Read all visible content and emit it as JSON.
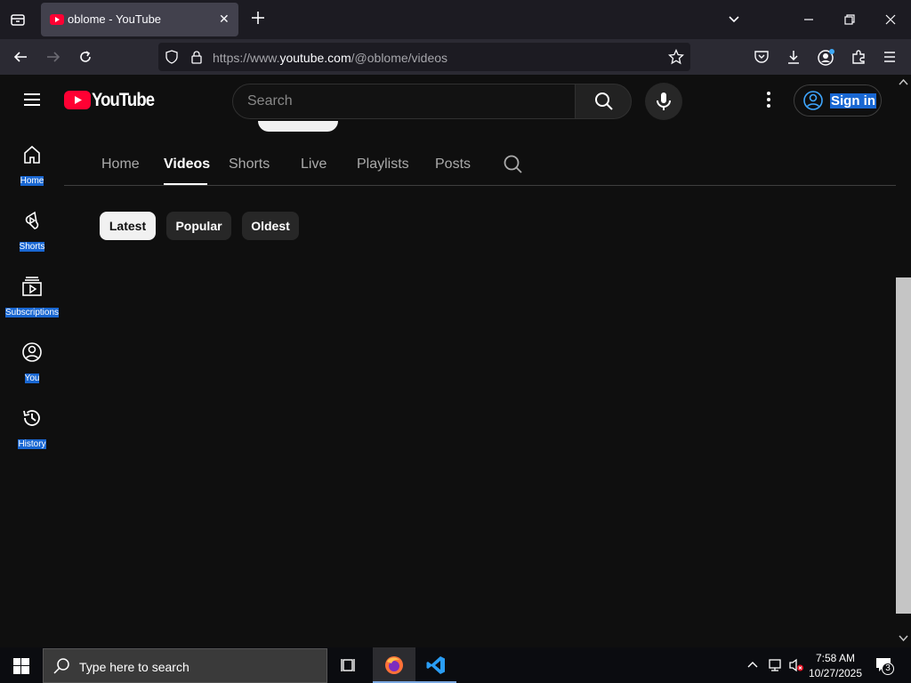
{
  "browser": {
    "tab_title": "oblome - YouTube",
    "url_prefix": "https://www.",
    "url_host": "youtube.com",
    "url_path": "/@oblome/videos"
  },
  "youtube": {
    "logo_text": "YouTube",
    "search_placeholder": "Search",
    "signin_label": "Sign in"
  },
  "sidebar": {
    "items": [
      {
        "label": "Home",
        "icon": "home-icon"
      },
      {
        "label": "Shorts",
        "icon": "shorts-icon"
      },
      {
        "label": "Subscriptions",
        "icon": "subscriptions-icon"
      },
      {
        "label": "You",
        "icon": "you-icon"
      },
      {
        "label": "History",
        "icon": "history-icon"
      }
    ]
  },
  "channel_tabs": {
    "items": [
      {
        "label": "Home"
      },
      {
        "label": "Videos",
        "active": true
      },
      {
        "label": "Shorts"
      },
      {
        "label": "Live"
      },
      {
        "label": "Playlists"
      },
      {
        "label": "Posts"
      }
    ]
  },
  "filters": {
    "chips": [
      {
        "label": "Latest",
        "active": true
      },
      {
        "label": "Popular"
      },
      {
        "label": "Oldest"
      }
    ]
  },
  "taskbar": {
    "search_text": "Type here to search",
    "time": "7:58 AM",
    "date": "10/27/2025",
    "notification_count": "3"
  },
  "colors": {
    "youtube_red": "#ff0033",
    "selection_blue": "#1967d2",
    "page_bg": "#0f0f0f"
  }
}
